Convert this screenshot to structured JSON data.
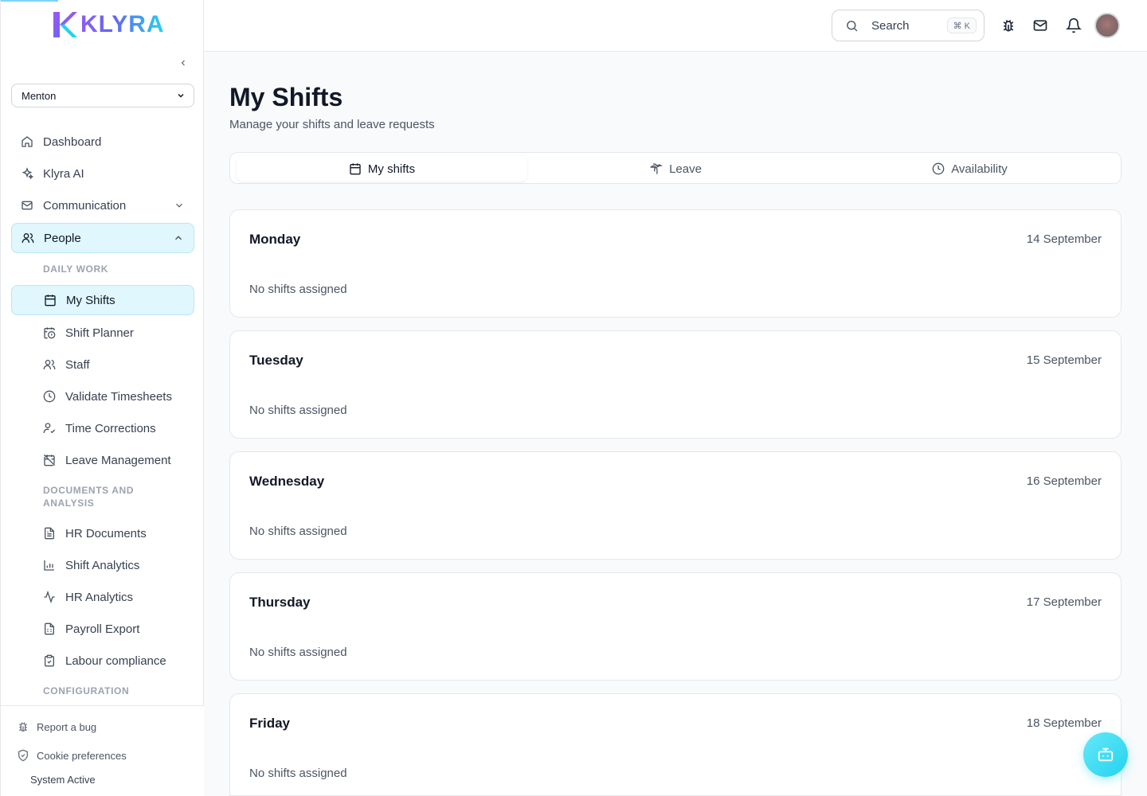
{
  "brand": {
    "name": "KLYRA",
    "colors": {
      "accent": "#22d3ee",
      "active_bg": "#e0f7fd",
      "logo_purple": "#8b5cf6"
    }
  },
  "sidebar": {
    "store_select": {
      "value": "Menton"
    },
    "nav": [
      {
        "label": "Dashboard",
        "icon": "home-icon"
      },
      {
        "label": "Klyra AI",
        "icon": "sparkles-icon"
      },
      {
        "label": "Communication",
        "icon": "mail-icon"
      },
      {
        "label": "People",
        "icon": "users-icon"
      }
    ],
    "sections": {
      "daily_work": "DAILY WORK",
      "documents": "DOCUMENTS AND ANALYSIS",
      "configuration": "CONFIGURATION"
    },
    "sub_items": [
      {
        "label": "My Shifts",
        "icon": "calendar-icon"
      },
      {
        "label": "Shift Planner",
        "icon": "calendar-clock-icon"
      },
      {
        "label": "Staff",
        "icon": "users-icon"
      },
      {
        "label": "Validate Timesheets",
        "icon": "clock-icon"
      },
      {
        "label": "Time Corrections",
        "icon": "user-check-icon"
      },
      {
        "label": "Leave Management",
        "icon": "calendar-off-icon"
      },
      {
        "label": "HR Documents",
        "icon": "file-text-icon"
      },
      {
        "label": "Shift Analytics",
        "icon": "bar-chart-icon"
      },
      {
        "label": "HR Analytics",
        "icon": "activity-icon"
      },
      {
        "label": "Payroll Export",
        "icon": "file-spreadsheet-icon"
      },
      {
        "label": "Labour compliance",
        "icon": "clipboard-check-icon"
      }
    ],
    "footer": {
      "report_bug": "Report a bug",
      "cookie_prefs": "Cookie preferences",
      "status": "System Active"
    }
  },
  "header": {
    "search": {
      "label": "Search",
      "shortcut": "⌘ K"
    }
  },
  "page": {
    "title": "My Shifts",
    "subtitle": "Manage your shifts and leave requests",
    "tabs": [
      {
        "label": "My shifts",
        "icon": "calendar-icon"
      },
      {
        "label": "Leave",
        "icon": "palm-tree-icon"
      },
      {
        "label": "Availability",
        "icon": "clock-icon"
      }
    ],
    "days": [
      {
        "name": "Monday",
        "date": "14 September",
        "empty": "No shifts assigned"
      },
      {
        "name": "Tuesday",
        "date": "15 September",
        "empty": "No shifts assigned"
      },
      {
        "name": "Wednesday",
        "date": "16 September",
        "empty": "No shifts assigned"
      },
      {
        "name": "Thursday",
        "date": "17 September",
        "empty": "No shifts assigned"
      },
      {
        "name": "Friday",
        "date": "18 September",
        "empty": "No shifts assigned"
      }
    ]
  }
}
